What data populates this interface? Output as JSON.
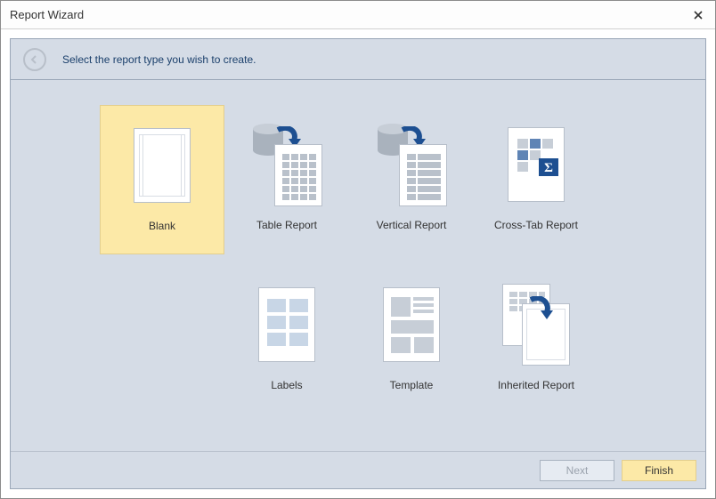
{
  "window": {
    "title": "Report Wizard"
  },
  "header": {
    "instruction": "Select the report type you wish to create."
  },
  "tiles": [
    {
      "label": "Blank"
    },
    {
      "label": "Table Report"
    },
    {
      "label": "Vertical Report"
    },
    {
      "label": "Cross-Tab Report"
    },
    {
      "label": "Labels"
    },
    {
      "label": "Template"
    },
    {
      "label": "Inherited Report"
    }
  ],
  "buttons": {
    "next": "Next",
    "finish": "Finish"
  },
  "selected_index": 0
}
